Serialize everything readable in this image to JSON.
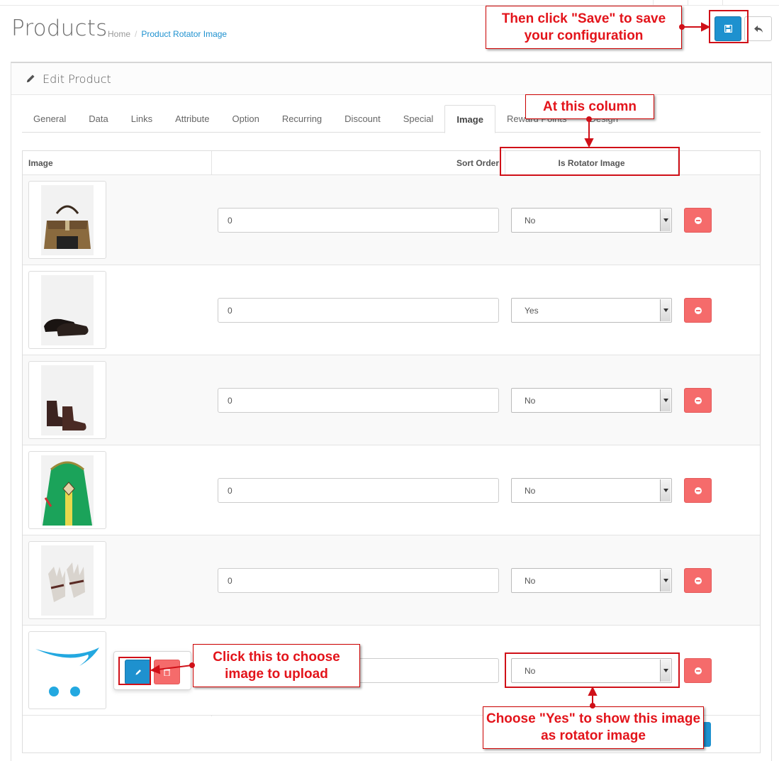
{
  "page": {
    "title": "Products",
    "breadcrumb": [
      "Home",
      "Product Rotator Image"
    ]
  },
  "header_buttons": {
    "save_icon": "floppy-disk-icon",
    "back_icon": "reply-arrow-icon"
  },
  "panel": {
    "title": "Edit Product",
    "icon": "pencil-icon"
  },
  "tabs": [
    {
      "label": "General",
      "active": false
    },
    {
      "label": "Data",
      "active": false
    },
    {
      "label": "Links",
      "active": false
    },
    {
      "label": "Attribute",
      "active": false
    },
    {
      "label": "Option",
      "active": false
    },
    {
      "label": "Recurring",
      "active": false
    },
    {
      "label": "Discount",
      "active": false
    },
    {
      "label": "Special",
      "active": false
    },
    {
      "label": "Image",
      "active": true
    },
    {
      "label": "Reward Points",
      "active": false
    },
    {
      "label": "Design",
      "active": false
    }
  ],
  "table": {
    "headers": {
      "image": "Image",
      "sort_order": "Sort Order",
      "is_rotator": "Is Rotator Image"
    },
    "rows": [
      {
        "image": "bag",
        "sort_order": "0",
        "is_rotator": "No"
      },
      {
        "image": "dress-shoes",
        "sort_order": "0",
        "is_rotator": "Yes"
      },
      {
        "image": "chelsea-boots",
        "sort_order": "0",
        "is_rotator": "No"
      },
      {
        "image": "green-backpack",
        "sort_order": "0",
        "is_rotator": "No"
      },
      {
        "image": "gloves",
        "sort_order": "0",
        "is_rotator": "No"
      },
      {
        "image": "placeholder-cart-logo",
        "sort_order": "",
        "is_rotator": "No"
      }
    ]
  },
  "annotations": {
    "save": "Then click \"Save\" to save your configuration",
    "column": "At this column",
    "upload": "Click this to choose image to upload",
    "choose_yes": "Choose \"Yes\" to show this image as rotator image"
  },
  "colors": {
    "primary": "#1e91cf",
    "danger": "#f56b6b",
    "annotation_red": "#e3141b"
  }
}
